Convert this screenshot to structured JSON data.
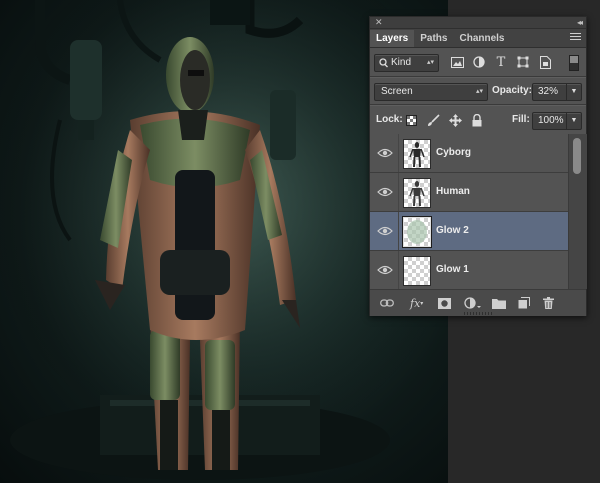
{
  "panel": {
    "tabs": [
      {
        "label": "Layers",
        "active": true
      },
      {
        "label": "Paths",
        "active": false
      },
      {
        "label": "Channels",
        "active": false
      }
    ],
    "filter": {
      "kind_label": "Kind"
    },
    "blend_mode": "Screen",
    "opacity_label": "Opacity:",
    "opacity_value": "32%",
    "lock_label": "Lock:",
    "fill_label": "Fill:",
    "fill_value": "100%",
    "layers": [
      {
        "name": "Cyborg",
        "visible": true,
        "selected": false,
        "thumb": "figure"
      },
      {
        "name": "Human",
        "visible": true,
        "selected": false,
        "thumb": "figure"
      },
      {
        "name": "Glow 2",
        "visible": true,
        "selected": true,
        "thumb": "glow"
      },
      {
        "name": "Glow 1",
        "visible": true,
        "selected": false,
        "thumb": "empty"
      }
    ],
    "footer_icons": [
      "link-icon",
      "fx-icon",
      "mask-icon",
      "adjustment-icon",
      "group-folder-icon",
      "new-layer-icon",
      "trash-icon"
    ]
  },
  "colors": {
    "panel_bg": "#535353",
    "selected_row": "#5e6b82",
    "artwork_glow": "#2f4a44"
  }
}
